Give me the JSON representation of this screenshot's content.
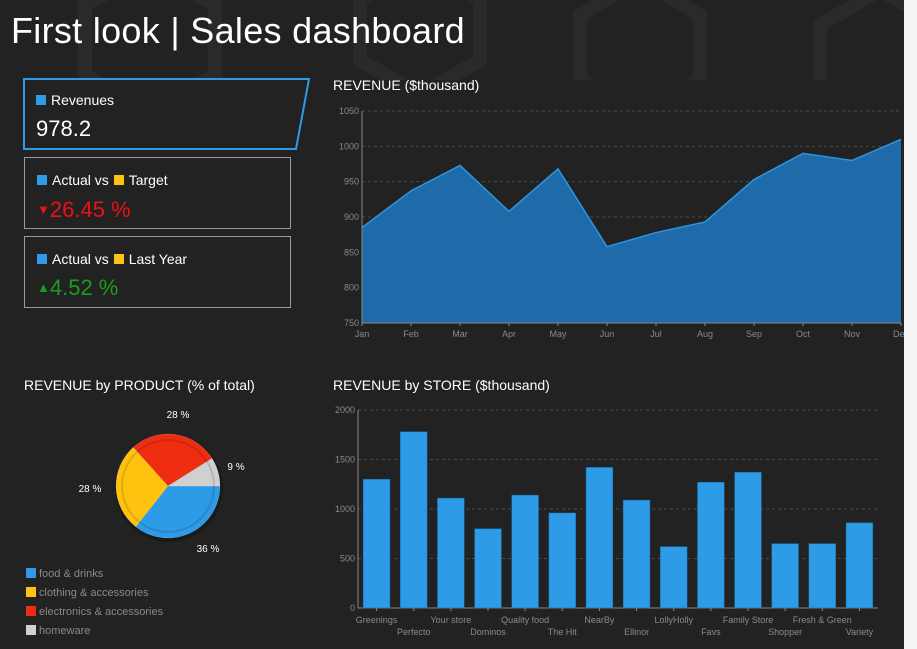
{
  "header": {
    "title": "First look | Sales dashboard"
  },
  "kpis": {
    "revenues": {
      "label": "Revenues",
      "value": "978.2"
    },
    "actual_vs_target": {
      "label_actual": "Actual vs",
      "label_target": "Target",
      "value": "26.45 %",
      "arrow": "▼"
    },
    "actual_vs_last_year": {
      "label_actual": "Actual vs",
      "label_target": "Last Year",
      "value": "4.52 %",
      "arrow": "▲"
    }
  },
  "colors": {
    "accent_blue": "#2e9be6",
    "accent_yellow": "#ffc20e",
    "negative": "#ee1111",
    "positive": "#1a9e1a",
    "area_fill": "#1f6aa8",
    "area_line": "#2c95de"
  },
  "chart_data": [
    {
      "id": "revenue_area",
      "type": "area",
      "title": "REVENUE ($thousand)",
      "categories": [
        "Jan",
        "Feb",
        "Mar",
        "Apr",
        "May",
        "Jun",
        "Jul",
        "Aug",
        "Sep",
        "Oct",
        "Nov",
        "Dec"
      ],
      "values": [
        885,
        937,
        973,
        908,
        968,
        858,
        878,
        893,
        953,
        990,
        980,
        1010
      ],
      "ylim": [
        750,
        1050
      ],
      "yticks": [
        750,
        800,
        850,
        900,
        950,
        1000,
        1050
      ],
      "grid": true
    },
    {
      "id": "revenue_by_product",
      "type": "pie",
      "title": "REVENUE by PRODUCT (% of total)",
      "slices": [
        {
          "name": "food & drinks",
          "value": 36,
          "label": "36 %",
          "color": "#2e9be6"
        },
        {
          "name": "clothing & accessories",
          "value": 28,
          "label": "28 %",
          "color": "#ffc20e"
        },
        {
          "name": "electronics & accessories",
          "value": 28,
          "label": "28 %",
          "color": "#ee2d11"
        },
        {
          "name": "homeware",
          "value": 9,
          "label": "9 %",
          "color": "#d0d0d0"
        }
      ],
      "legend_position": "bottom-left"
    },
    {
      "id": "revenue_by_store",
      "type": "bar",
      "title": "REVENUE by STORE ($thousand)",
      "categories": [
        "Greenings",
        "Perfecto",
        "Your store",
        "Dominos",
        "Quality food",
        "The Hit",
        "NearBy",
        "Ellinor",
        "LollyHolly",
        "Favs",
        "Family Store",
        "Shopper",
        "Fresh & Green",
        "Variety"
      ],
      "values": [
        1300,
        1780,
        1110,
        800,
        1140,
        960,
        1420,
        1090,
        620,
        1270,
        1370,
        650,
        650,
        860
      ],
      "ylim": [
        0,
        2000
      ],
      "yticks": [
        0,
        500,
        1000,
        1500,
        2000
      ],
      "grid": true
    }
  ]
}
